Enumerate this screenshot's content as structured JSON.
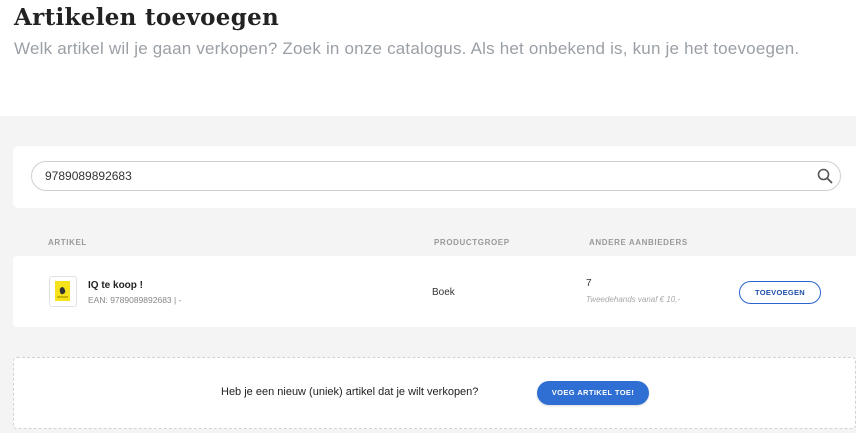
{
  "header": {
    "title": "Artikelen toevoegen",
    "subtitle": "Welk artikel wil je gaan verkopen? Zoek in onze catalogus. Als het onbekend is, kun je het toevoegen."
  },
  "search": {
    "value": "9789089892683",
    "icon": "search-icon"
  },
  "table": {
    "columns": [
      "ARTIKEL",
      "PRODUCTGROEP",
      "ANDERE AANBIEDERS"
    ],
    "rows": [
      {
        "thumbnail_icon": "book-cover-thumbnail",
        "name": "IQ te koop !",
        "ean": "EAN: 9789089892683  |  -",
        "group": "Boek",
        "other_sellers": "7",
        "used_price": "Tweedehands vanaf € 10,-",
        "action": "TOEVOEGEN"
      }
    ]
  },
  "cta": {
    "text": "Heb je een nieuw (uniek) artikel dat je wilt verkopen?",
    "button": "VOEG ARTIKEL TOE!"
  },
  "colors": {
    "accent": "#2f6fd3",
    "title": "#222222",
    "subtitle": "#9aa0a6",
    "background": "#f4f4f4"
  }
}
